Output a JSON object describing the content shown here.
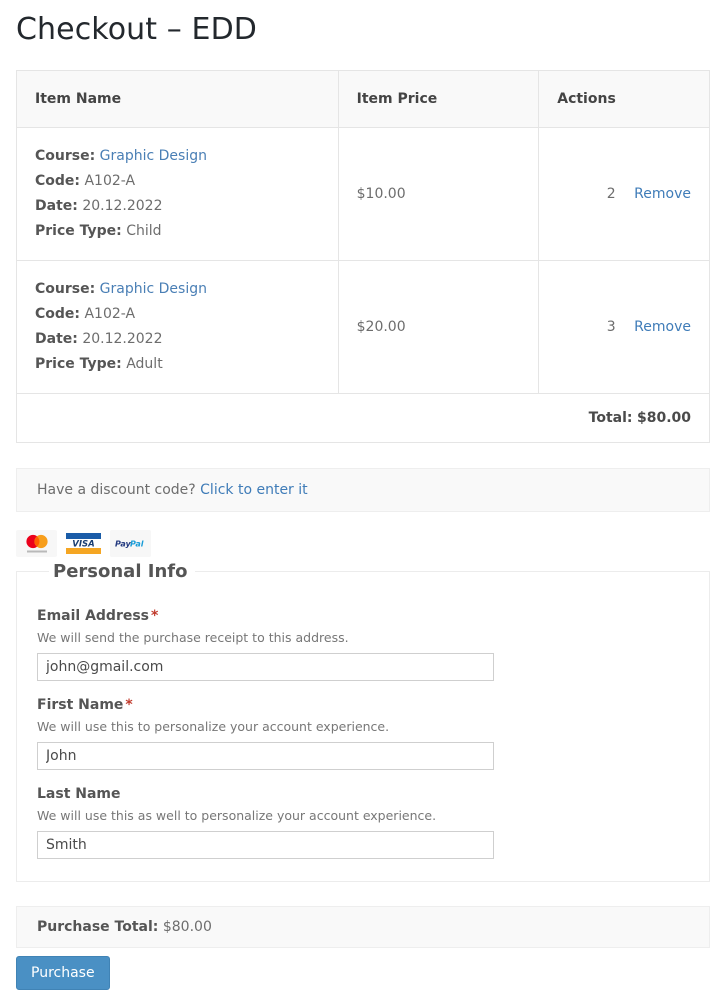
{
  "page": {
    "title": "Checkout – EDD"
  },
  "cart": {
    "columns": {
      "name": "Item Name",
      "price": "Item Price",
      "actions": "Actions"
    },
    "labels": {
      "course": "Course:",
      "code": "Code:",
      "date": "Date:",
      "price_type": "Price Type:",
      "remove": "Remove"
    },
    "items": [
      {
        "course": "Graphic Design",
        "code": "A102-A",
        "date": "20.12.2022",
        "price_type": "Child",
        "price": "$10.00",
        "quantity": "2"
      },
      {
        "course": "Graphic Design",
        "code": "A102-A",
        "date": "20.12.2022",
        "price_type": "Adult",
        "price": "$20.00",
        "quantity": "3"
      }
    ],
    "total_label": "Total:",
    "total_value": "$80.00"
  },
  "discount": {
    "text": "Have a discount code?",
    "link": "Click to enter it"
  },
  "payment_icons": [
    {
      "name": "mastercard-icon",
      "label": "mastercard"
    },
    {
      "name": "visa-icon",
      "label": "VISA"
    },
    {
      "name": "paypal-icon",
      "label": "PayPal"
    }
  ],
  "personal_info": {
    "legend": "Personal Info",
    "fields": [
      {
        "label": "Email Address",
        "required": true,
        "required_mark": "*",
        "description": "We will send the purchase receipt to this address.",
        "value": "john@gmail.com",
        "placeholder": ""
      },
      {
        "label": "First Name",
        "required": true,
        "required_mark": "*",
        "description": "We will use this to personalize your account experience.",
        "value": "John",
        "placeholder": ""
      },
      {
        "label": "Last Name",
        "required": false,
        "required_mark": "",
        "description": "We will use this as well to personalize your account experience.",
        "value": "Smith",
        "placeholder": ""
      }
    ]
  },
  "footer": {
    "purchase_total_label": "Purchase Total:",
    "purchase_total_value": "$80.00",
    "purchase_button": "Purchase"
  },
  "colors": {
    "link": "#3f7cb8",
    "button": "#4a90c4",
    "required": "#c0392b",
    "title": "#23282d"
  }
}
